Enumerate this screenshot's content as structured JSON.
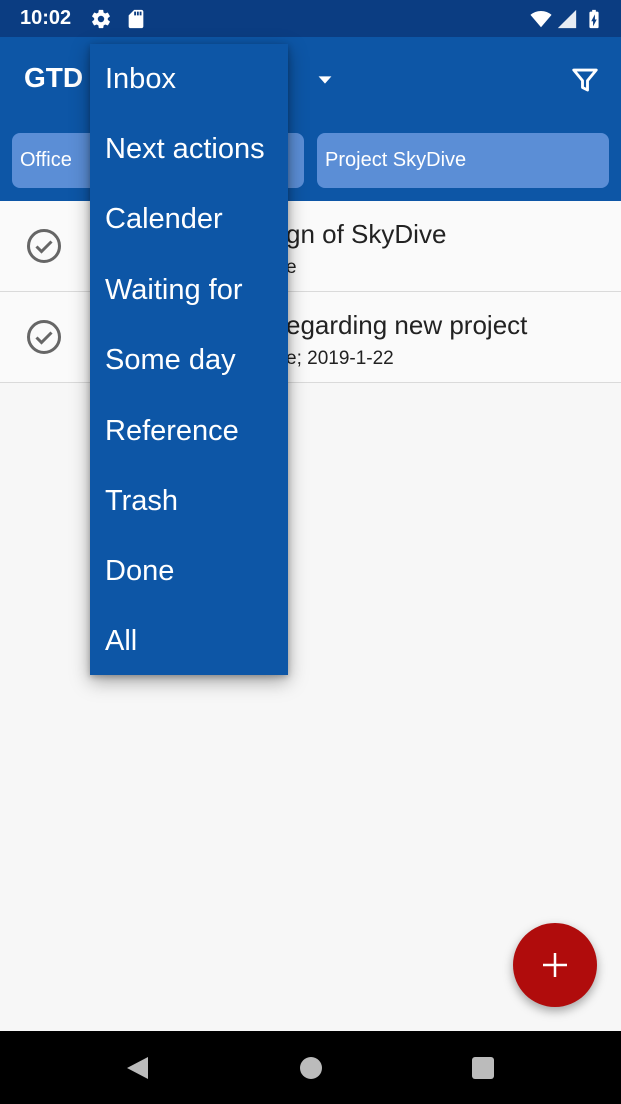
{
  "status_bar": {
    "time": "10:02",
    "icons": [
      "settings-icon",
      "sd-card-icon",
      "wifi-icon",
      "signal-icon",
      "battery-icon"
    ]
  },
  "app_bar": {
    "title": "GTD",
    "dropdown_icon": "chevron-down-icon",
    "filter_icon": "filter-icon"
  },
  "chips": [
    {
      "label": "Office"
    },
    {
      "label": "Project SkyDive"
    }
  ],
  "tasks": [
    {
      "title": "gn of SkyDive",
      "subtitle": "e"
    },
    {
      "title": "egarding new project",
      "subtitle": "e; 2019-1-22"
    }
  ],
  "menu": {
    "items": [
      {
        "label": "Inbox"
      },
      {
        "label": "Next actions"
      },
      {
        "label": "Calender"
      },
      {
        "label": "Waiting for"
      },
      {
        "label": "Some day"
      },
      {
        "label": "Reference"
      },
      {
        "label": "Trash"
      },
      {
        "label": "Done"
      },
      {
        "label": "All"
      }
    ]
  },
  "fab": {
    "icon": "plus-icon"
  },
  "colors": {
    "status_bar": "#0b3d82",
    "primary": "#0d56a6",
    "chip": "#5b8ed6",
    "fab": "#b00c0c",
    "background": "#f7f7f7"
  }
}
